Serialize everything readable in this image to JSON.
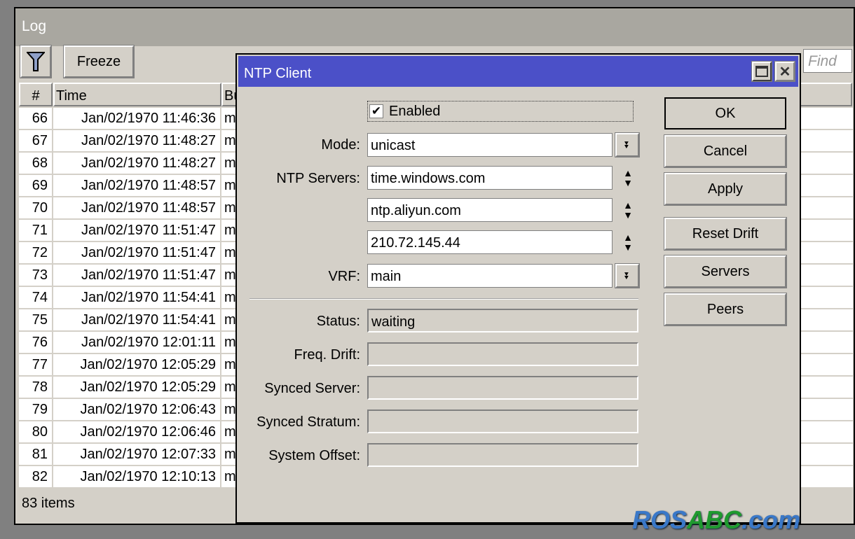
{
  "log": {
    "title": "Log",
    "freeze_label": "Freeze",
    "find_placeholder": "Find",
    "footer": "83 items",
    "columns": [
      "#",
      "Time",
      "Bu"
    ],
    "rows": [
      {
        "n": "66",
        "time": "Jan/02/1970 11:46:36",
        "b": "m"
      },
      {
        "n": "67",
        "time": "Jan/02/1970 11:48:27",
        "b": "m"
      },
      {
        "n": "68",
        "time": "Jan/02/1970 11:48:27",
        "b": "m"
      },
      {
        "n": "69",
        "time": "Jan/02/1970 11:48:57",
        "b": "m"
      },
      {
        "n": "70",
        "time": "Jan/02/1970 11:48:57",
        "b": "m"
      },
      {
        "n": "71",
        "time": "Jan/02/1970 11:51:47",
        "b": "m"
      },
      {
        "n": "72",
        "time": "Jan/02/1970 11:51:47",
        "b": "m"
      },
      {
        "n": "73",
        "time": "Jan/02/1970 11:51:47",
        "b": "m"
      },
      {
        "n": "74",
        "time": "Jan/02/1970 11:54:41",
        "b": "m"
      },
      {
        "n": "75",
        "time": "Jan/02/1970 11:54:41",
        "b": "m"
      },
      {
        "n": "76",
        "time": "Jan/02/1970 12:01:11",
        "b": "m"
      },
      {
        "n": "77",
        "time": "Jan/02/1970 12:05:29",
        "b": "m"
      },
      {
        "n": "78",
        "time": "Jan/02/1970 12:05:29",
        "b": "m"
      },
      {
        "n": "79",
        "time": "Jan/02/1970 12:06:43",
        "b": "m"
      },
      {
        "n": "80",
        "time": "Jan/02/1970 12:06:46",
        "b": "m"
      },
      {
        "n": "81",
        "time": "Jan/02/1970 12:07:33",
        "b": "m"
      },
      {
        "n": "82",
        "time": "Jan/02/1970 12:10:13",
        "b": "m"
      }
    ]
  },
  "dialog": {
    "title": "NTP Client",
    "enabled_label": "Enabled",
    "enabled": true,
    "mode_label": "Mode:",
    "mode": "unicast",
    "servers_label": "NTP Servers:",
    "servers": [
      "time.windows.com",
      "ntp.aliyun.com",
      "210.72.145.44"
    ],
    "vrf_label": "VRF:",
    "vrf": "main",
    "status_label": "Status:",
    "status": "waiting",
    "drift_label": "Freq. Drift:",
    "drift": "",
    "synced_server_label": "Synced Server:",
    "synced_server": "",
    "stratum_label": "Synced Stratum:",
    "stratum": "",
    "offset_label": "System Offset:",
    "offset": "",
    "buttons": [
      "OK",
      "Cancel",
      "Apply",
      "Reset Drift",
      "Servers",
      "Peers"
    ]
  },
  "watermark": "ROSABC.com",
  "colors": {
    "titlebar": "#4b50c8",
    "window": "#d4d0c8"
  }
}
